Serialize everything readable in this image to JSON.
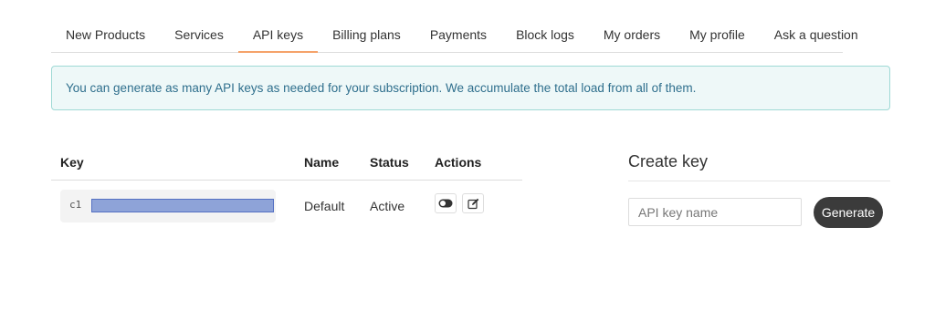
{
  "nav": {
    "tabs": [
      {
        "label": "New Products"
      },
      {
        "label": "Services"
      },
      {
        "label": "API keys",
        "active": true
      },
      {
        "label": "Billing plans"
      },
      {
        "label": "Payments"
      },
      {
        "label": "Block logs"
      },
      {
        "label": "My orders"
      },
      {
        "label": "My profile"
      },
      {
        "label": "Ask a question"
      }
    ]
  },
  "alert": {
    "text": "You can generate as many API keys as needed for your subscription. We accumulate the total load from all of them."
  },
  "keys_table": {
    "headers": {
      "key": "Key",
      "name": "Name",
      "status": "Status",
      "actions": "Actions"
    },
    "rows": [
      {
        "key_prefix": "c1",
        "name": "Default",
        "status": "Active",
        "action_icons": [
          "toggle-icon",
          "edit-icon"
        ]
      }
    ]
  },
  "create": {
    "title": "Create key",
    "input_placeholder": "API key name",
    "input_value": "",
    "button_label": "Generate"
  },
  "colors": {
    "active_tab_underline": "#f5a26a",
    "alert_bg": "#eef8f8",
    "alert_border": "#9fd9d5",
    "alert_text": "#2f6f8d",
    "generate_button": "#3b3b3b",
    "key_mask": "#8ea3d8"
  }
}
